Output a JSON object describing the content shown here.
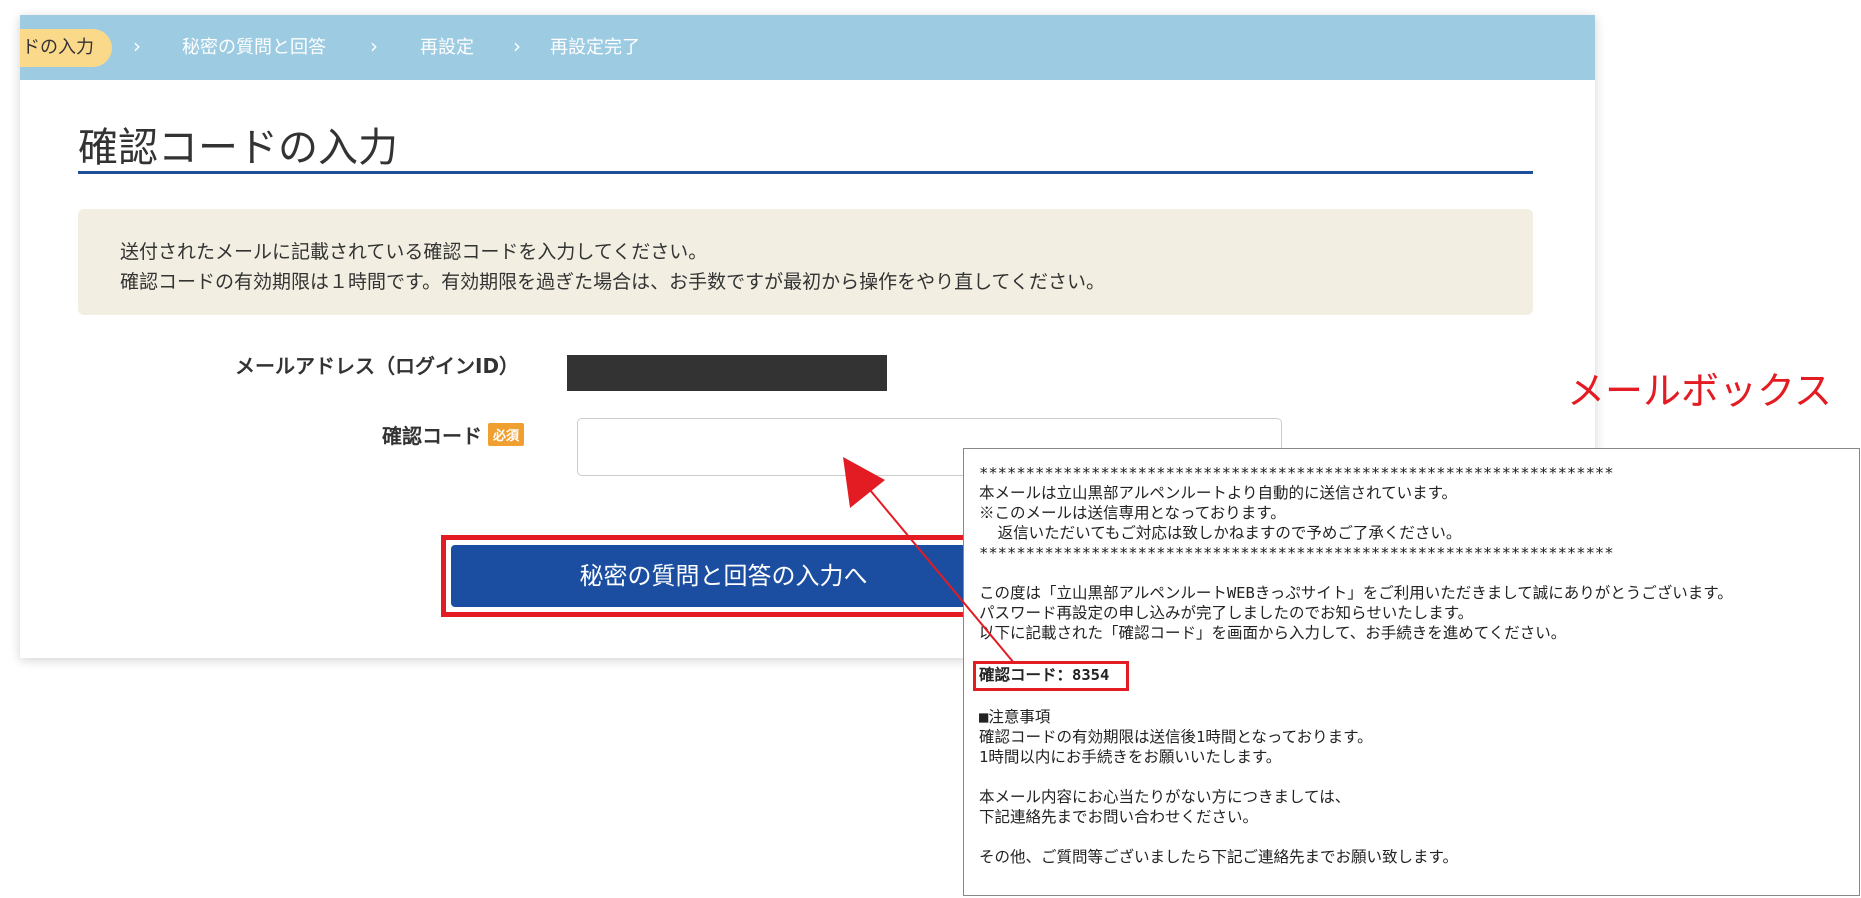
{
  "steps": [
    {
      "label": "ドの入力",
      "active": true
    },
    {
      "label": "秘密の質問と回答",
      "active": false
    },
    {
      "label": "再設定",
      "active": false
    },
    {
      "label": "再設定完了",
      "active": false
    }
  ],
  "chevron": "›",
  "page": {
    "title": "確認コードの入力",
    "notice": [
      "送付されたメールに記載されている確認コードを入力してください。",
      "確認コードの有効期限は１時間です。有効期限を過ぎた場合は、お手数ですが最初から操作をやり直してください。"
    ]
  },
  "form": {
    "email_label": "メールアドレス（ログインID）",
    "code_label": "確認コード",
    "required_badge": "必須",
    "code_value": "",
    "submit_label": "秘密の質問と回答の入力へ"
  },
  "mailbox": {
    "title": "メールボックス",
    "lines": [
      "********************************************************************",
      "本メールは立山黒部アルペンルートより自動的に送信されています。",
      "※このメールは送信専用となっております。",
      "  返信いただいてもご対応は致しかねますので予めご了承ください。",
      "********************************************************************",
      "",
      "この度は「立山黒部アルペンルートWEBきっぷサイト」をご利用いただきまして誠にありがとうございます。",
      "パスワード再設定の申し込みが完了しましたのでお知らせいたします。",
      "以下に記載された「確認コード」を画面から入力して、お手続きを進めてください。",
      "",
      "確認コード：8354",
      "",
      "■注意事項",
      "確認コードの有効期限は送信後1時間となっております。",
      "1時間以内にお手続きをお願いいたします。",
      "",
      "本メール内容にお心当たりがない方につきましては、",
      "下記連絡先までお問い合わせください。",
      "",
      "その他、ご質問等ございましたら下記ご連絡先までお願い致します。"
    ]
  },
  "colors": {
    "steps_bar": "#9ccbe2",
    "active_step": "#fbd98a",
    "title_rule": "#1f4f9a",
    "submit_button": "#1b4ea0",
    "highlight": "#e31b23",
    "required_badge": "#f0a030"
  }
}
